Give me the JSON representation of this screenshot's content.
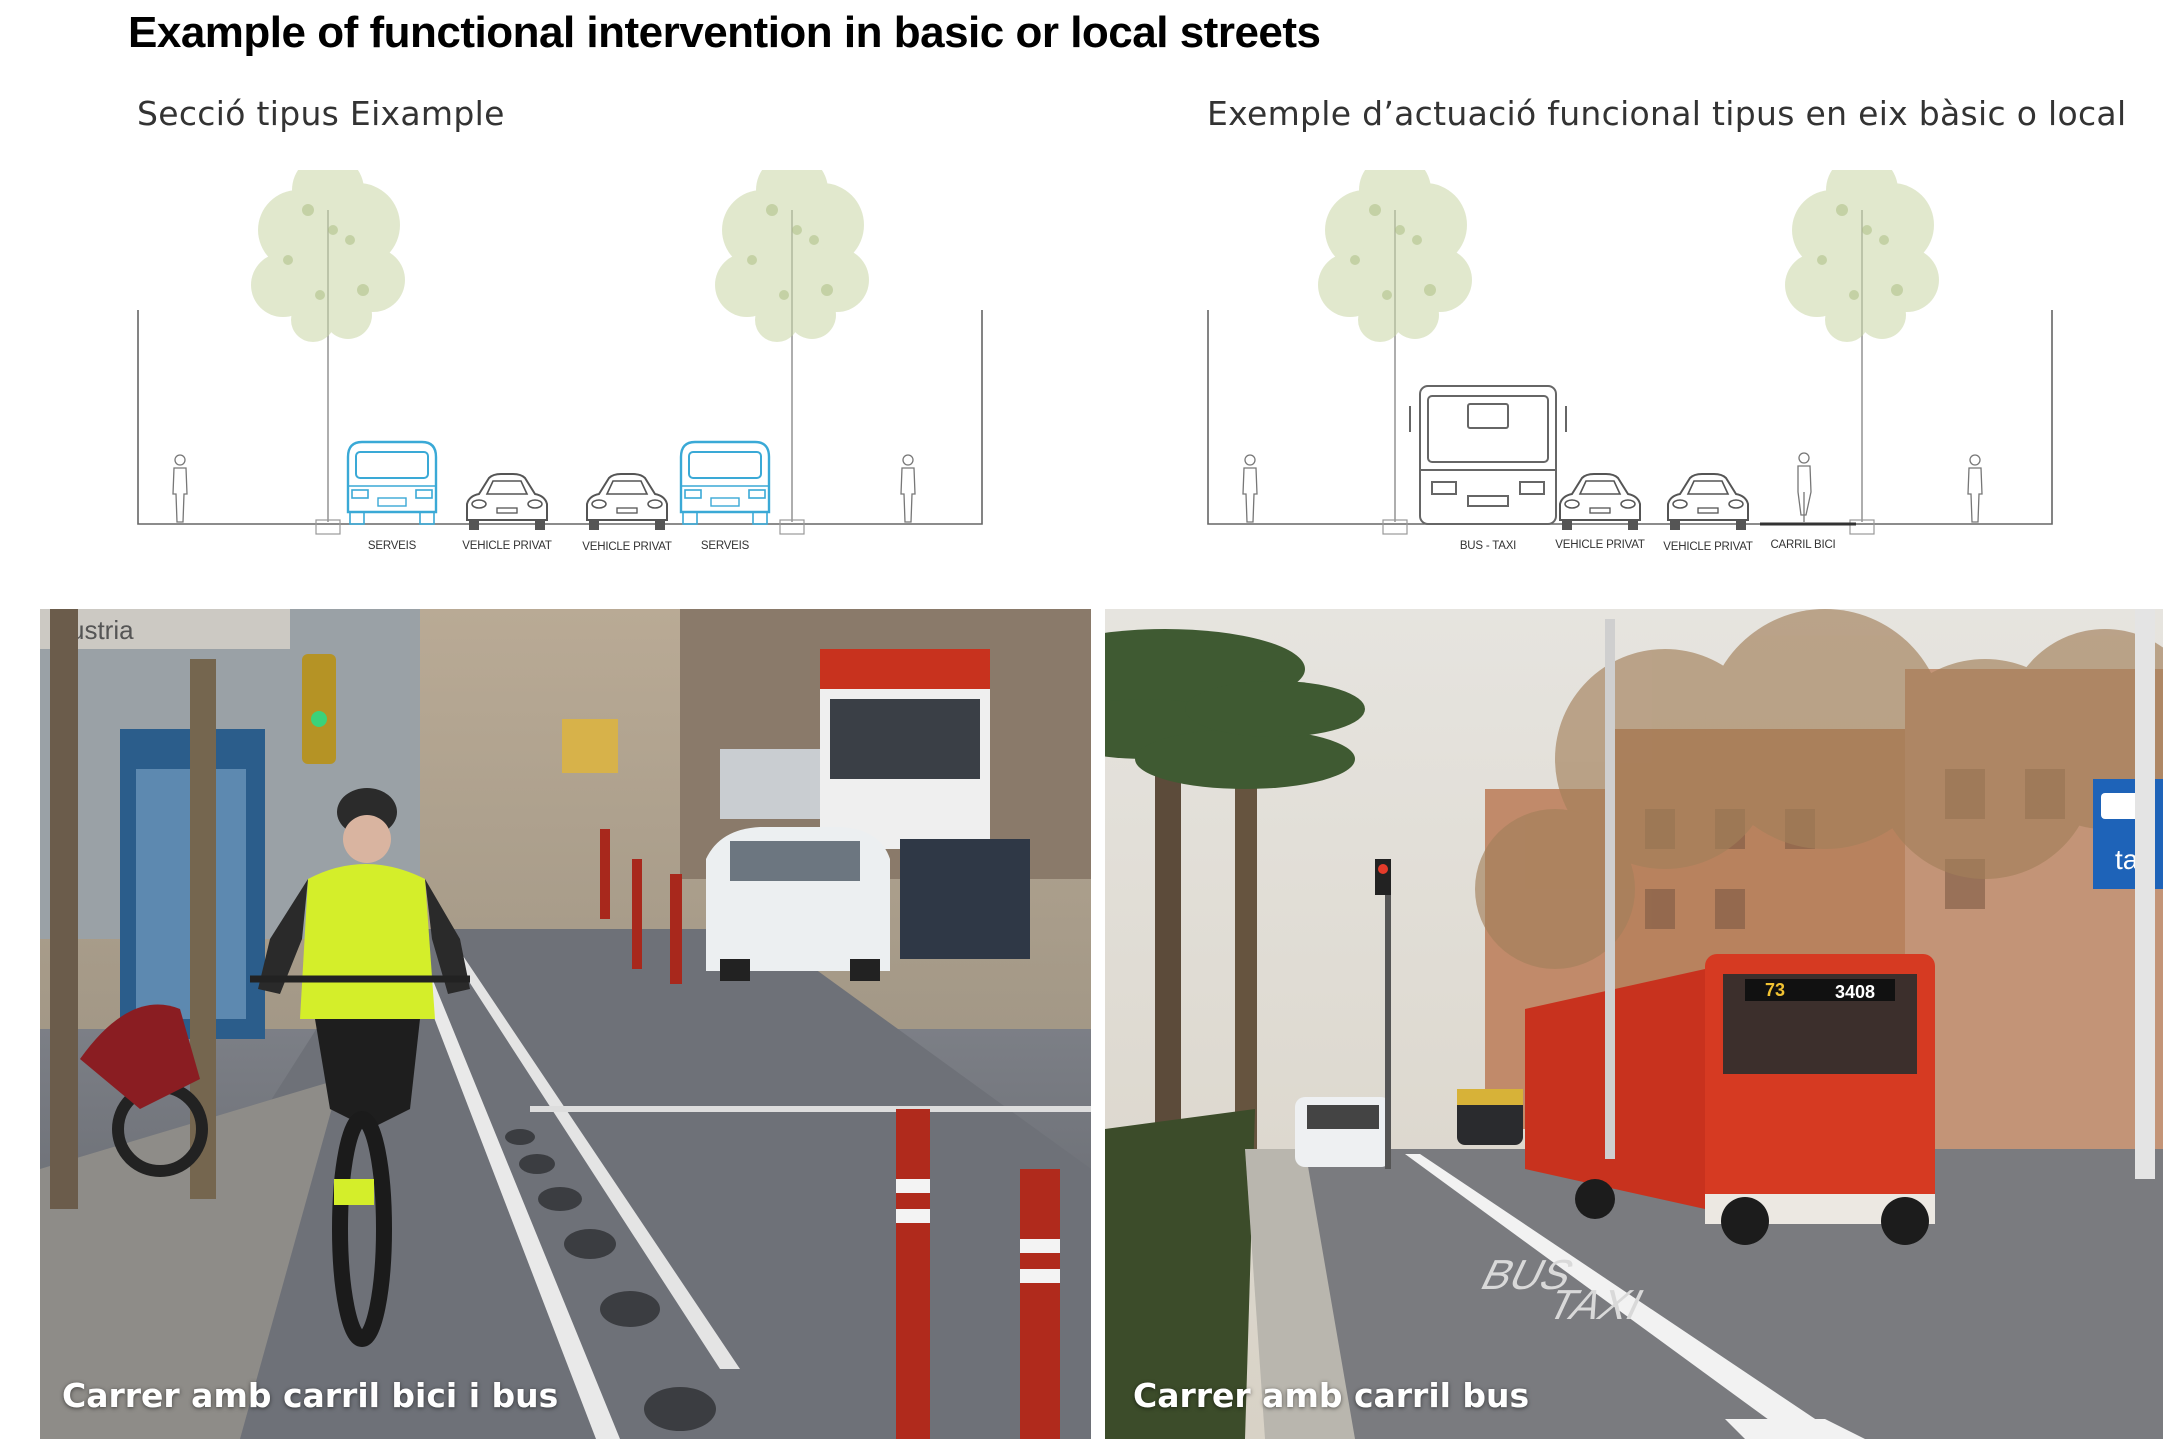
{
  "page": {
    "title": "Example of functional intervention in basic or local streets"
  },
  "left_section": {
    "title": "Secció tipus Eixample",
    "lanes": [
      "SERVEIS",
      "VEHICLE PRIVAT",
      "VEHICLE PRIVAT",
      "SERVEIS"
    ],
    "photo_caption": "Carrer amb carril bici i bus",
    "sign_text": "ustria"
  },
  "right_section": {
    "title": "Exemple d’actuació funcional tipus en eix bàsic o local",
    "lanes": [
      "BUS - TAXI",
      "VEHICLE PRIVAT",
      "VEHICLE PRIVAT",
      "CARRIL BICI"
    ],
    "photo_caption": "Carrer amb carril bus",
    "bus_number": "3408",
    "bus_line": "73",
    "sign_text": "tax",
    "road_marking_1": "BUS",
    "road_marking_2": "TAXI"
  },
  "colors": {
    "service_vehicle": "#3aa9d6",
    "bus_red": "#c8321e",
    "hivis_yellow": "#d4ee2a",
    "bollard_red": "#b02a1c"
  }
}
